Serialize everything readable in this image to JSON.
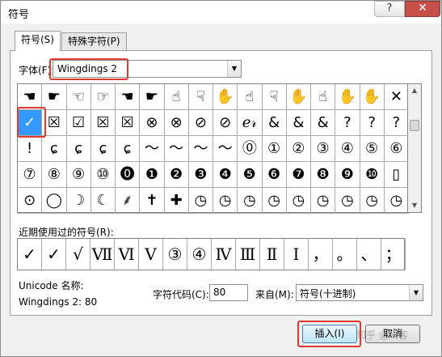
{
  "window": {
    "title": "符号",
    "help_btn": "?",
    "close_btn": "✕"
  },
  "tabs": [
    {
      "label": "符号(S)"
    },
    {
      "label": "特殊字符(P)"
    }
  ],
  "font": {
    "label": "字体(F):",
    "value": "Wingdings 2"
  },
  "symbol_grid": [
    [
      "☚",
      "☛",
      "☜",
      "☞",
      "☚",
      "☛",
      "☝",
      "☟",
      "✋",
      "☝",
      "☟",
      "✋",
      "☝",
      "✋",
      "✋",
      "✕"
    ],
    [
      "✓",
      "☒",
      "☑",
      "☒",
      "☒",
      "⊗",
      "⊗",
      "⊘",
      "⊘",
      "ℯ𝓇",
      "&",
      "&",
      "&",
      "?",
      "?",
      "?"
    ],
    [
      "!",
      "ɕ",
      "ɕ",
      "ɕ",
      "ɕ",
      "〜",
      "〜",
      "〜",
      "〜",
      "⓪",
      "①",
      "②",
      "③",
      "④",
      "⑤",
      "⑥"
    ],
    [
      "⑦",
      "⑧",
      "⑨",
      "⑩",
      "⓿",
      "❶",
      "❷",
      "❸",
      "❹",
      "❺",
      "❻",
      "❼",
      "❽",
      "❾",
      "❿",
      "▯"
    ],
    [
      "⊙",
      "◯",
      "☽",
      "☾",
      "⸙",
      "✝",
      "✚",
      "◷",
      "◷",
      "◷",
      "◷",
      "◷",
      "◷",
      "◷",
      "◷",
      "◷"
    ]
  ],
  "recent": {
    "label": "近期使用过的符号(R):",
    "items": [
      "✓",
      "✓",
      "√",
      "Ⅶ",
      "Ⅵ",
      "Ⅴ",
      "③",
      "④",
      "Ⅳ",
      "Ⅲ",
      "Ⅱ",
      "Ⅰ",
      "，",
      "。",
      "、",
      "；"
    ]
  },
  "unicode": {
    "label": "Unicode 名称:",
    "name": "Wingdings 2: 80"
  },
  "char_code": {
    "label": "字符代码(C):",
    "value": "80"
  },
  "from": {
    "label": "来自(M):",
    "value": "符号(十进制)"
  },
  "buttons": {
    "insert": "插入(I)",
    "cancel": "取消"
  },
  "watermark": "知乎 @闲客",
  "colors": {
    "selection": "#3399ff",
    "highlight": "#e03a2e"
  }
}
